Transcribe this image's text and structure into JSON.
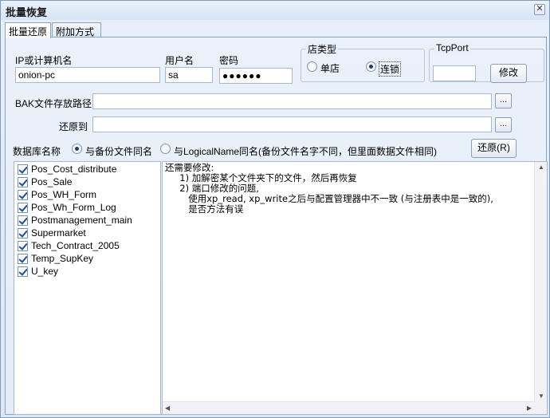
{
  "window": {
    "title": "批量恢复",
    "close_label": "✕"
  },
  "tabs": [
    {
      "label": "批量还原",
      "active": true
    },
    {
      "label": "附加方式",
      "active": false
    }
  ],
  "connection": {
    "ip_label": "IP或计算机名",
    "ip_value": "onion-pc",
    "user_label": "用户名",
    "user_value": "sa",
    "password_label": "密码",
    "password_value": "●●●●●●"
  },
  "store_type": {
    "title": "店类型",
    "options": [
      {
        "label": "单店",
        "selected": false
      },
      {
        "label": "连锁",
        "selected": true
      }
    ]
  },
  "tcp_port": {
    "title": "TcpPort",
    "value": "",
    "modify_label": "修改"
  },
  "paths": {
    "bak_label": "BAK文件存放路径",
    "bak_value": "",
    "restore_to_label": "还原到",
    "restore_to_value": "",
    "browse_label": "..."
  },
  "db_name": {
    "label": "数据库名称",
    "options": [
      {
        "label": "与备份文件同名",
        "selected": true
      },
      {
        "label": "与LogicalName同名(备份文件名字不同，但里面数据文件相同)",
        "selected": false
      }
    ],
    "restore_label": "还原(R)"
  },
  "databases": [
    {
      "name": "Pos_Cost_distribute",
      "checked": true
    },
    {
      "name": "Pos_Sale",
      "checked": true
    },
    {
      "name": "Pos_WH_Form",
      "checked": true
    },
    {
      "name": "Pos_Wh_Form_Log",
      "checked": true
    },
    {
      "name": "Postmanagement_main",
      "checked": true
    },
    {
      "name": "Supermarket",
      "checked": true
    },
    {
      "name": "Tech_Contract_2005",
      "checked": true
    },
    {
      "name": "Temp_SupKey",
      "checked": true
    },
    {
      "name": "U_key",
      "checked": true
    }
  ],
  "notes": {
    "line1": "还需要修改:",
    "line2": "     1) 加解密某个文件夹下的文件，然后再恢复",
    "line3": "     2) 端口修改的问题,",
    "line4": "        使用xp_read, xp_write之后与配置管理器中不一致 (与注册表中是一致的),",
    "line5": "        是否方法有误"
  }
}
